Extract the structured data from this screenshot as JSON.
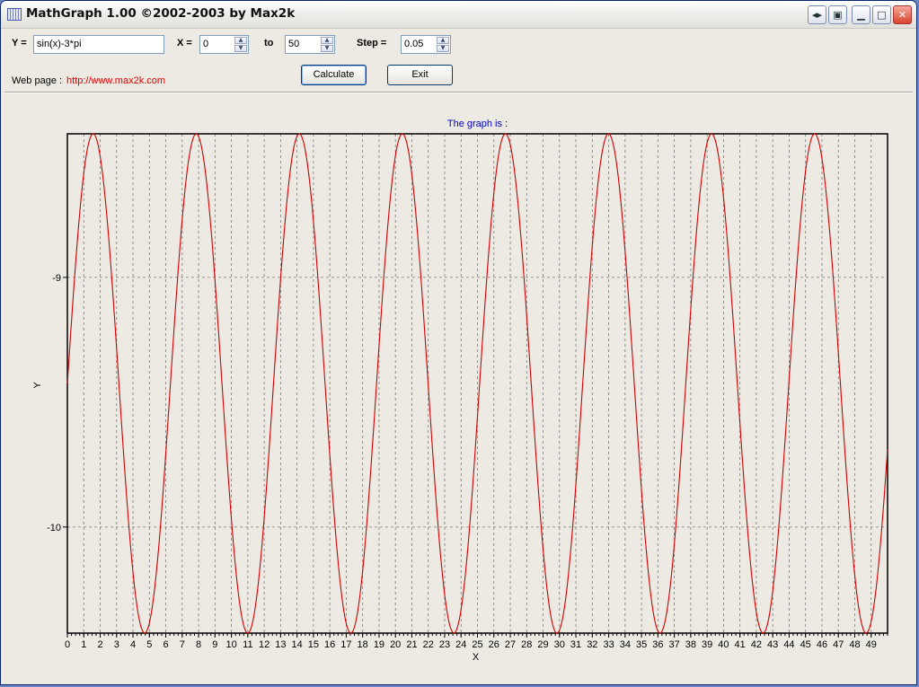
{
  "window": {
    "title": "MathGraph 1.00 ©2002-2003 by Max2k"
  },
  "title_buttons": [
    "restore-left-right",
    "tray",
    "minimize",
    "maximize",
    "close"
  ],
  "form": {
    "y_label": "Y =",
    "y_value": "sin(x)-3*pi",
    "x_label": "X =",
    "x_from": "0",
    "to_label": "to",
    "x_to": "50",
    "step_label": "Step =",
    "step_value": "0.05",
    "web_label": "Web page :",
    "web_url": "http://www.max2k.com",
    "calculate_label": "Calculate",
    "exit_label": "Exit"
  },
  "colors": {
    "curve": "#d00000",
    "caption": "#0000cc",
    "link": "#e00000"
  },
  "chart_data": {
    "type": "line",
    "caption": "The graph is :",
    "function": "sin(x)-3*pi",
    "x_range": [
      0,
      50
    ],
    "x_step": 0.05,
    "xlim": [
      0,
      50
    ],
    "ylim": [
      -10.42478,
      -8.42478
    ],
    "x_ticks": [
      "0",
      "1",
      "2",
      "3",
      "4",
      "5",
      "6",
      "7",
      "8",
      "9",
      "10",
      "11",
      "12",
      "13",
      "14",
      "15",
      "16",
      "17",
      "18",
      "19",
      "20",
      "21",
      "22",
      "23",
      "24",
      "25",
      "26",
      "27",
      "28",
      "29",
      "30",
      "31",
      "32",
      "33",
      "34",
      "35",
      "36",
      "37",
      "38",
      "39",
      "40",
      "41",
      "42",
      "43",
      "44",
      "45",
      "46",
      "47",
      "48",
      "49"
    ],
    "y_ticks": [
      "-9",
      "-10"
    ],
    "xlabel": "X",
    "ylabel": "Y",
    "grid": true,
    "series": [
      {
        "expression": "sin(x)-3*pi"
      }
    ]
  }
}
